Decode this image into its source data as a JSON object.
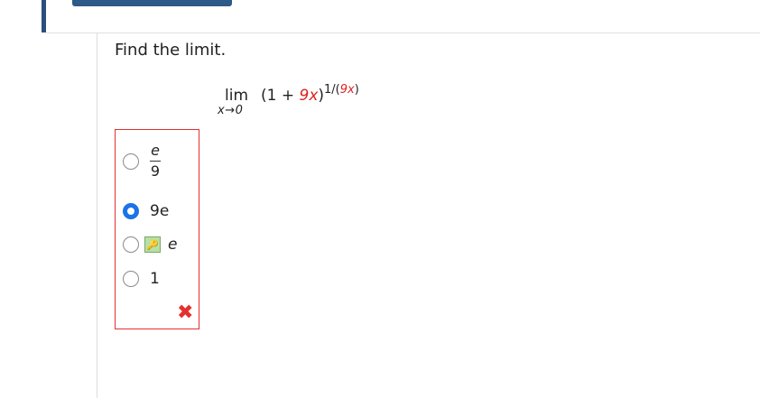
{
  "question": {
    "prompt": "Find the limit.",
    "limit": {
      "word": "lim",
      "subscript": "x→0",
      "open": "(1 + ",
      "coefficient": "9x",
      "close": ")",
      "exp_prefix": "1/(",
      "exp_inner": "9x",
      "exp_suffix": ")"
    }
  },
  "answer_options": [
    {
      "numerator": "e",
      "denominator": "9",
      "selected": false
    },
    {
      "label": "9e",
      "selected": true
    },
    {
      "label": "e",
      "selected": false,
      "icon": "key-icon"
    },
    {
      "label": "1",
      "selected": false
    }
  ],
  "feedback": {
    "icon": "x-mark-icon",
    "state": "incorrect"
  },
  "colors": {
    "accent": "#1a73e8",
    "error": "#e53030",
    "header": "#2d5a86",
    "key_bg": "#b7e0a4"
  }
}
